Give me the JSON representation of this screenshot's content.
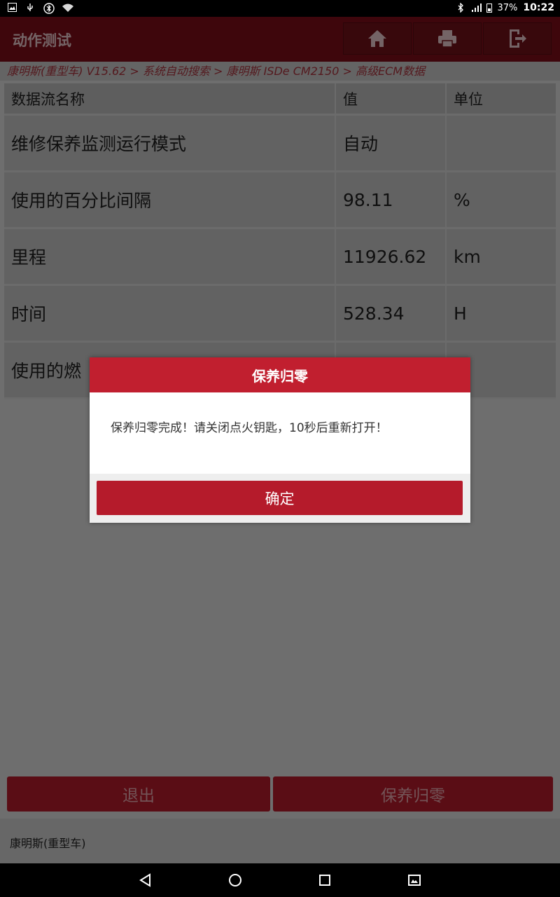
{
  "status_bar": {
    "time": "10:22",
    "battery": "37%",
    "icons": [
      "image-icon",
      "usb-icon",
      "bluetooth-icon",
      "wifi-icon",
      "signal-icon"
    ]
  },
  "app": {
    "title": "动作测试",
    "header_buttons": [
      "home-icon",
      "print-icon",
      "exit-icon"
    ],
    "breadcrumb": "康明斯(重型车) V15.62 > 系统自动搜索 > 康明斯 ISDe CM2150 > 高级ECM数据"
  },
  "table": {
    "headers": {
      "name": "数据流名称",
      "value": "值",
      "unit": "单位"
    },
    "rows": [
      {
        "name": "维修保养监测运行模式",
        "value": "自动",
        "unit": ""
      },
      {
        "name": "使用的百分比间隔",
        "value": "98.11",
        "unit": "%"
      },
      {
        "name": "里程",
        "value": "11926.62",
        "unit": "km"
      },
      {
        "name": "时间",
        "value": "528.34",
        "unit": "H"
      },
      {
        "name": "使用的燃",
        "value": "",
        "unit": ""
      }
    ]
  },
  "bottom": {
    "exit_label": "退出",
    "reset_label": "保养归零",
    "status_text": "康明斯(重型车)"
  },
  "dialog": {
    "title": "保养归零",
    "message": "保养归零完成！请关闭点火钥匙，10秒后重新打开！",
    "ok_label": "确定"
  },
  "colors": {
    "header": "#7d0d19",
    "accent": "#c11f2f",
    "button": "#b51b2b"
  }
}
